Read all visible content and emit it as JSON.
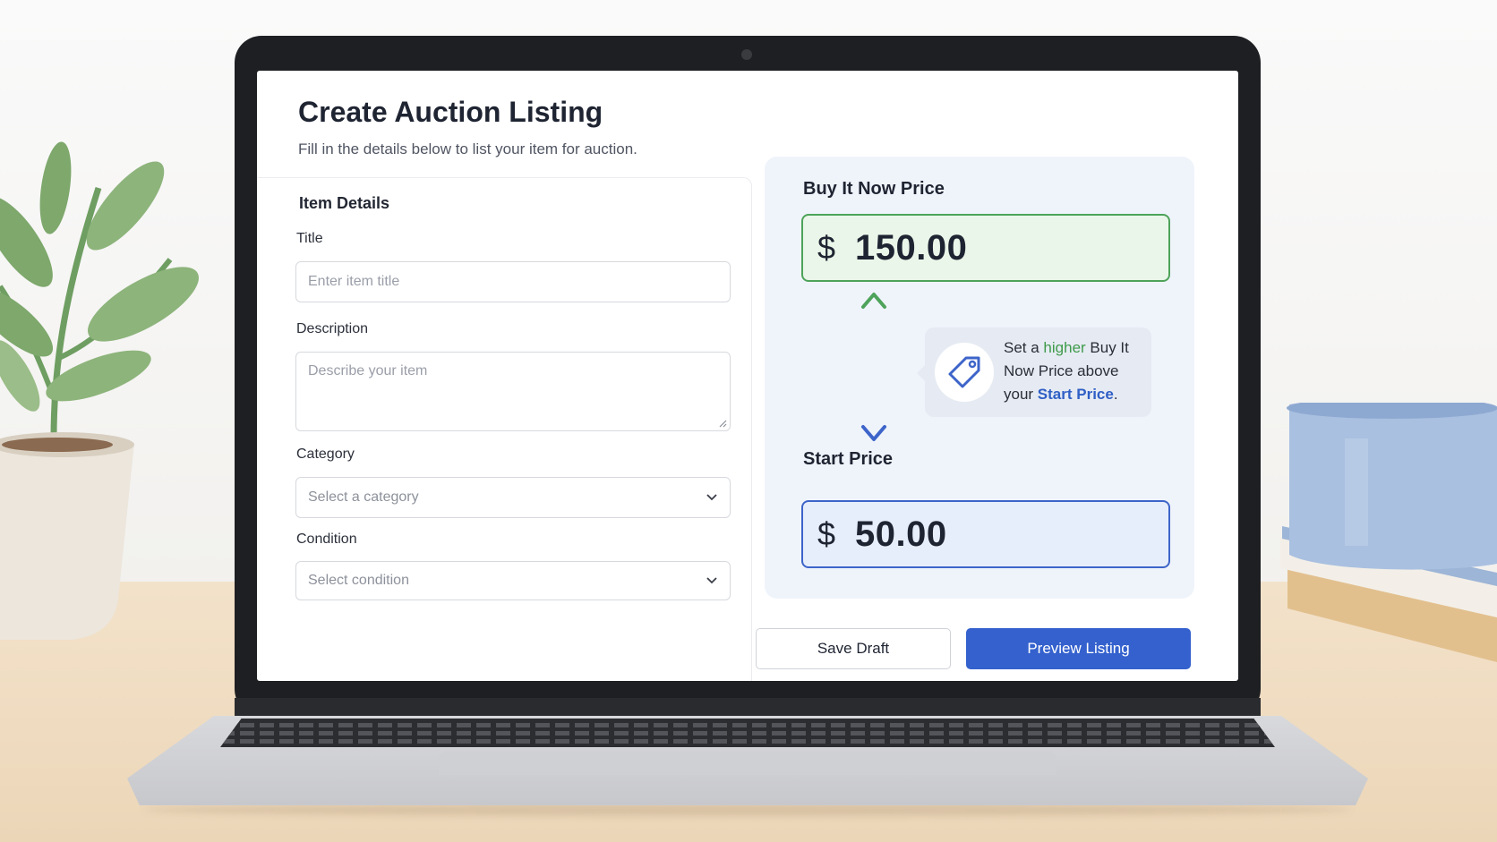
{
  "page": {
    "title": "Create Auction Listing",
    "subtitle": "Fill in the details below to list your item for auction."
  },
  "item_details": {
    "section_title": "Item Details",
    "title_label": "Title",
    "title_placeholder": "Enter item title",
    "description_label": "Description",
    "description_placeholder": "Describe your item",
    "category_label": "Category",
    "category_value": "Select a category",
    "condition_label": "Condition",
    "condition_value": "Select condition"
  },
  "pricing": {
    "buy_now_label": "Buy It Now Price",
    "buy_now_currency": "$",
    "buy_now_amount": "150.00",
    "start_label": "Start Price",
    "start_currency": "$",
    "start_amount": "50.00",
    "tip_prefix": "Set a ",
    "tip_highlight_1": "higher",
    "tip_middle": " Buy It Now Price above your ",
    "tip_highlight_2": "Start Price",
    "tip_suffix": ".",
    "tip_icon": "tag-icon",
    "arrow_up_color": "#4ea35a",
    "arrow_down_color": "#3d64c9"
  },
  "actions": {
    "save_draft_label": "Save Draft",
    "preview_label": "Preview Listing"
  },
  "colors": {
    "primary": "#3461cd",
    "success": "#4ea35a"
  }
}
